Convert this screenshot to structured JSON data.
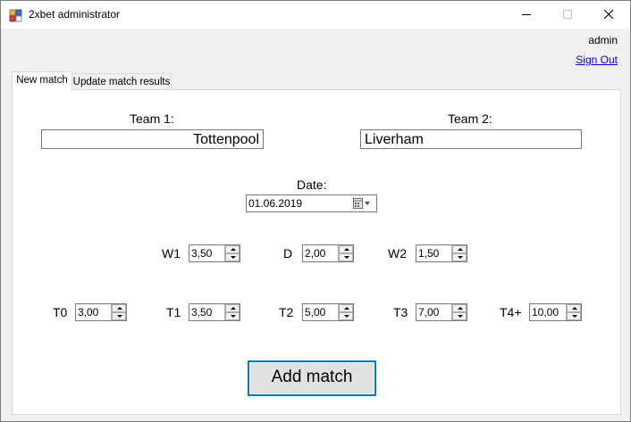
{
  "window": {
    "title": "2xbet administrator"
  },
  "user": {
    "name": "admin",
    "sign_out_label": "Sign Out"
  },
  "tabs": [
    {
      "label": "New match",
      "active": true
    },
    {
      "label": "Update match results",
      "active": false
    }
  ],
  "form": {
    "team1_label": "Team 1:",
    "team1_value": "Tottenpool",
    "team2_label": "Team 2:",
    "team2_value": "Liverham",
    "date_label": "Date:",
    "date_value": "01.06.2019",
    "odds": [
      {
        "label": "W1",
        "value": "3,50"
      },
      {
        "label": "D",
        "value": "2,00"
      },
      {
        "label": "W2",
        "value": "1,50"
      }
    ],
    "totals": [
      {
        "label": "T0",
        "value": "3,00"
      },
      {
        "label": "T1",
        "value": "3,50"
      },
      {
        "label": "T2",
        "value": "5,00"
      },
      {
        "label": "T3",
        "value": "7,00"
      },
      {
        "label": "T4+",
        "value": "10,00"
      }
    ],
    "submit_label": "Add match"
  },
  "colors": {
    "link": "#0000ff",
    "focus_border": "#0078d7"
  },
  "icons": [
    "app-icon",
    "minimize-icon",
    "maximize-icon",
    "close-icon",
    "calendar-icon",
    "dropdown-arrow-icon",
    "spin-up-icon",
    "spin-down-icon"
  ]
}
